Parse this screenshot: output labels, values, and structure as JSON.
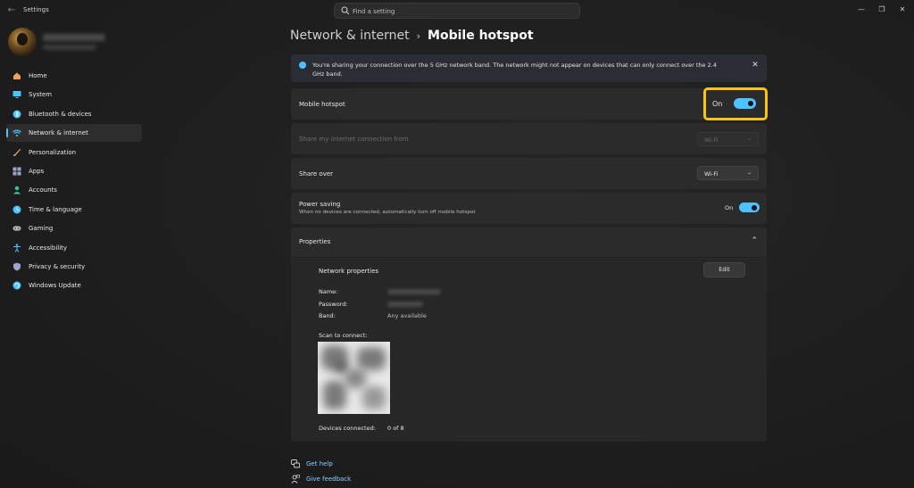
{
  "app": {
    "title": "Settings",
    "search_placeholder": "Find a setting"
  },
  "sidebar": {
    "items": [
      {
        "label": "Home",
        "icon": "home-icon",
        "color": "#f1a35a"
      },
      {
        "label": "System",
        "icon": "monitor-icon",
        "color": "#4cc2ff"
      },
      {
        "label": "Bluetooth & devices",
        "icon": "bluetooth-icon",
        "color": "#4cc2ff"
      },
      {
        "label": "Network & internet",
        "icon": "wifi-icon",
        "color": "#4cc2ff"
      },
      {
        "label": "Personalization",
        "icon": "brush-icon",
        "color": "#f1a35a"
      },
      {
        "label": "Apps",
        "icon": "apps-icon",
        "color": "#9aa7c9"
      },
      {
        "label": "Accounts",
        "icon": "person-icon",
        "color": "#37c28f"
      },
      {
        "label": "Time & language",
        "icon": "globe-clock-icon",
        "color": "#4cc2ff"
      },
      {
        "label": "Gaming",
        "icon": "gamepad-icon",
        "color": "#b8b8b8"
      },
      {
        "label": "Accessibility",
        "icon": "accessibility-icon",
        "color": "#4cc2ff"
      },
      {
        "label": "Privacy & security",
        "icon": "shield-icon",
        "color": "#9aa7c9"
      },
      {
        "label": "Windows Update",
        "icon": "update-icon",
        "color": "#4cc2ff"
      }
    ],
    "active_index": 3
  },
  "breadcrumb": {
    "parent": "Network & internet",
    "separator": "›",
    "current": "Mobile hotspot"
  },
  "info_banner": {
    "text": "You're sharing your connection over the 5 GHz network band. The network might not appear on devices that can only connect over the 2.4 GHz band.",
    "close": "✕"
  },
  "mobile_hotspot": {
    "label": "Mobile hotspot",
    "state": "On"
  },
  "share_from": {
    "label": "Share my internet connection from",
    "value": "Wi-Fi"
  },
  "share_over": {
    "label": "Share over",
    "value": "Wi-Fi"
  },
  "power_saving": {
    "label": "Power saving",
    "description": "When no devices are connected, automatically turn off mobile hotspot",
    "state": "On"
  },
  "properties": {
    "label": "Properties",
    "network_properties": "Network properties",
    "edit": "Edit",
    "name_label": "Name:",
    "password_label": "Password:",
    "band_label": "Band:",
    "band_value": "Any available",
    "scan_label": "Scan to connect:",
    "devices_label": "Devices connected:",
    "devices_value": "0 of 8"
  },
  "links": {
    "help": "Get help",
    "feedback": "Give feedback"
  },
  "colors": {
    "accent": "#4cc2ff",
    "highlight": "#f5c518"
  }
}
